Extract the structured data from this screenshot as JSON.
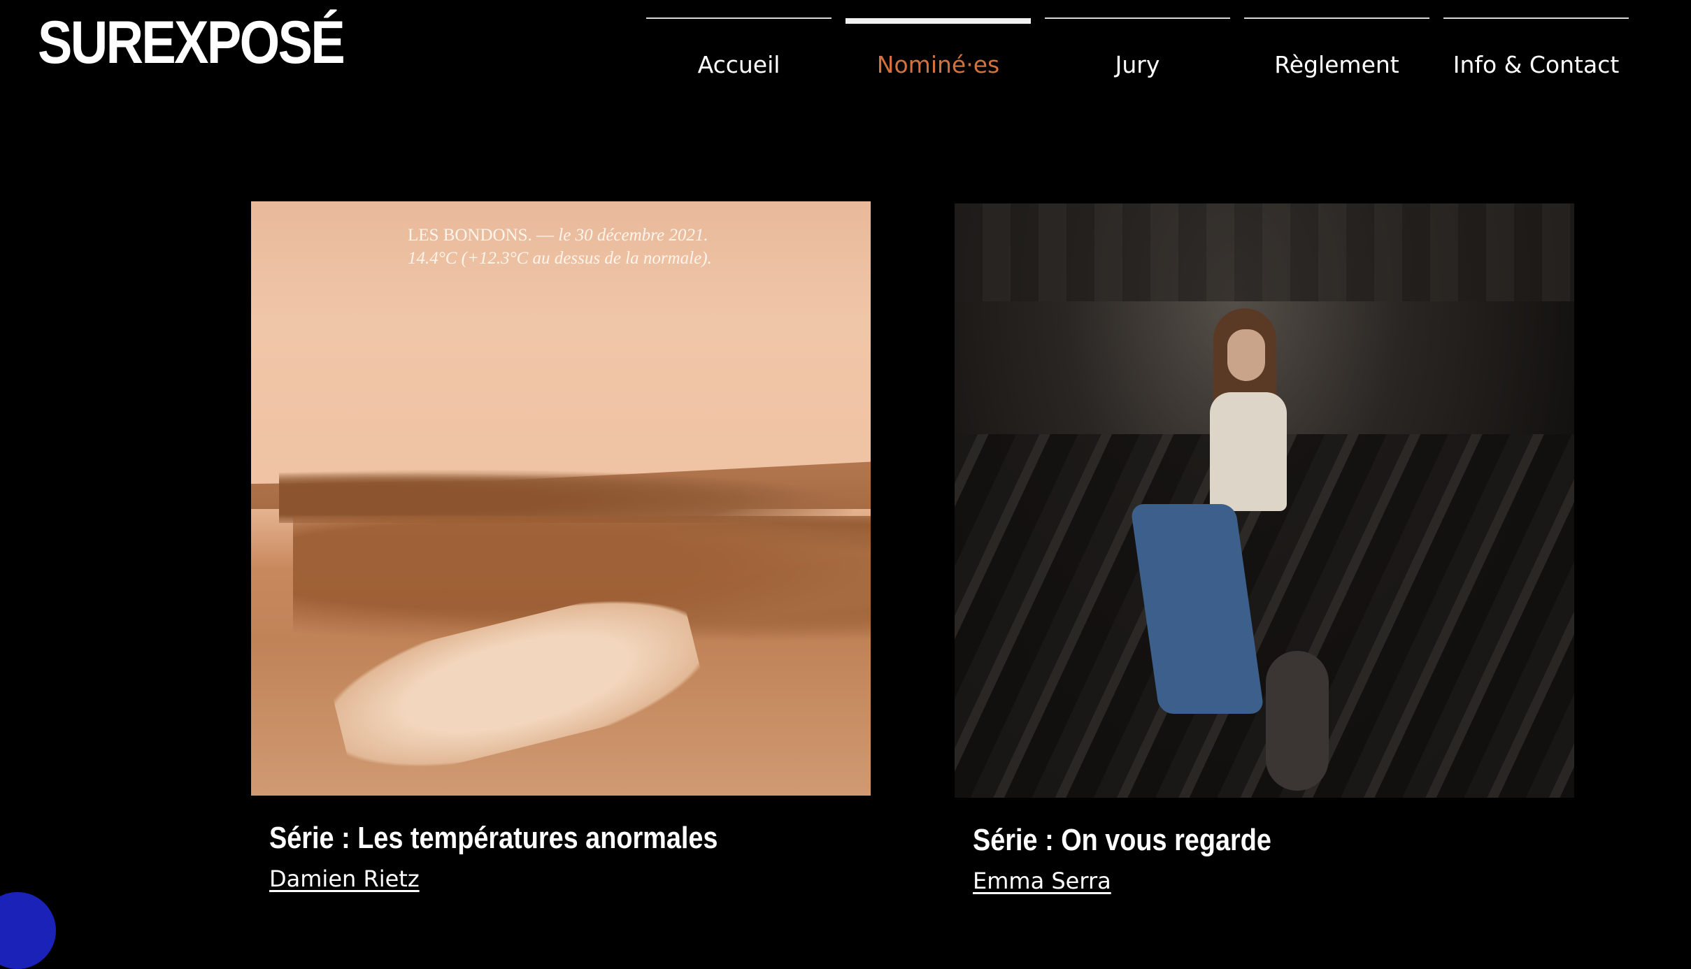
{
  "site": {
    "logo": "SUREXPOSÉ"
  },
  "nav": {
    "items": [
      {
        "label": "Accueil",
        "active": false
      },
      {
        "label": "Nominé·es",
        "active": true
      },
      {
        "label": "Jury",
        "active": false
      },
      {
        "label": "Règlement",
        "active": false
      },
      {
        "label": "Info & Contact",
        "active": false
      }
    ]
  },
  "nominees": [
    {
      "photo_caption_place": "LES BONDONS. —",
      "photo_caption_date": "le 30 décembre 2021.",
      "photo_caption_temp": "14.4°C (+12.3°C au dessus de la normale).",
      "title": "Série : Les températures anormales",
      "author": "Damien Rietz"
    },
    {
      "title": "Série : On vous regarde",
      "author": "Emma Serra"
    }
  ],
  "colors": {
    "accent": "#d2723c",
    "background": "#000000",
    "chat": "#1b22b8"
  }
}
